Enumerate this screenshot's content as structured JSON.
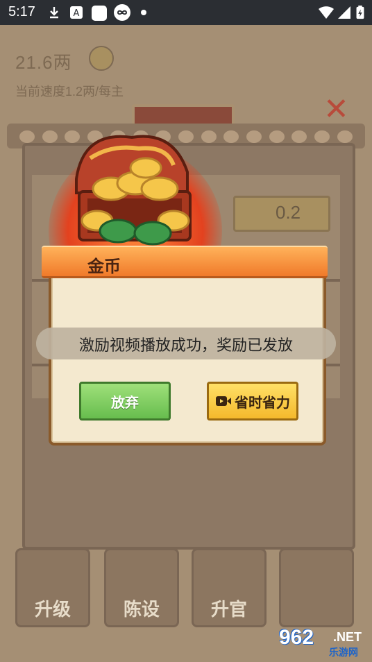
{
  "status_bar": {
    "time": "5:17",
    "icons": [
      "download-icon",
      "app-a-icon",
      "square-app-icon",
      "infinity-icon",
      "dot-icon",
      "wifi-icon",
      "signal-icon",
      "battery-icon"
    ]
  },
  "game": {
    "currency_amount": "21.6两",
    "speed_text": "当前速度1.2两/每主",
    "upgrade_sign": "升级",
    "value_box": "0.2",
    "bottom_tabs": [
      "升级",
      "陈设",
      "升官"
    ]
  },
  "dialog": {
    "title": "金币",
    "toast": "激励视频播放成功，奖励已发放",
    "abandon_button": "放弃",
    "save_time_button": "省时省力"
  },
  "watermark": {
    "number": "962",
    "suffix": ".NET",
    "subtitle": "乐游网"
  },
  "colors": {
    "accent_orange": "#f07a2a",
    "button_green": "#67bd4e",
    "button_yellow": "#f4b92c",
    "status_bar": "#2b2e33"
  }
}
